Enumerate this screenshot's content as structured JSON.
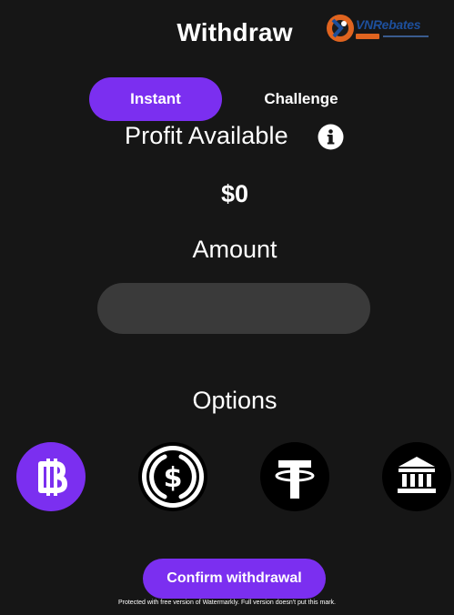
{
  "header": {
    "title": "Withdraw",
    "logo_text": "VNRebates"
  },
  "tabs": [
    {
      "label": "Instant",
      "active": true
    },
    {
      "label": "Challenge",
      "active": false
    }
  ],
  "profit": {
    "label": "Profit Available",
    "value": "$0",
    "info_icon": "info-icon"
  },
  "amount": {
    "label": "Amount",
    "value": "",
    "placeholder": ""
  },
  "options": {
    "label": "Options",
    "items": [
      {
        "icon": "bitcoin-icon",
        "selected": true
      },
      {
        "icon": "usdc-icon",
        "selected": false
      },
      {
        "icon": "tether-icon",
        "selected": false
      },
      {
        "icon": "bank-icon",
        "selected": false
      }
    ]
  },
  "confirm": {
    "label": "Confirm withdrawal"
  },
  "watermark": "Protected with free version of Watermarkly. Full version doesn't put this mark.",
  "colors": {
    "background": "#161616",
    "accent": "#7b2ff0",
    "input": "#3a3a3a",
    "option_bg": "#000000"
  }
}
